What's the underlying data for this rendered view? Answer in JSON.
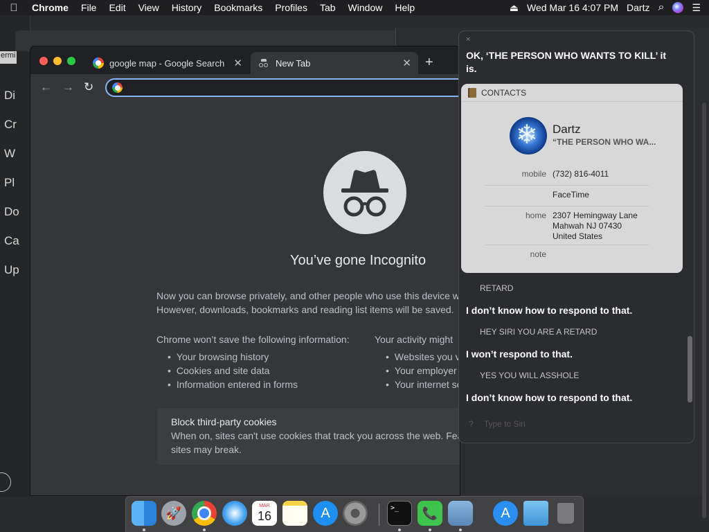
{
  "menubar": {
    "apple_icon": "apple-logo",
    "app_name": "Chrome",
    "items": [
      "File",
      "Edit",
      "View",
      "History",
      "Bookmarks",
      "Profiles",
      "Tab",
      "Window",
      "Help"
    ],
    "datetime": "Wed Mar 16  4:07 PM",
    "user": "Dartz",
    "eject_glyph": "⏏",
    "search_glyph": "⌕",
    "list_glyph": "☰"
  },
  "background_windows": {
    "terminal_tab_fragment": "ermi",
    "sidebar_letters": [
      "Di",
      "Cr",
      "W",
      "Pl",
      "Do",
      "Ca",
      "Up"
    ]
  },
  "chrome": {
    "tabs": [
      {
        "title": "google map - Google Search",
        "close": "✕"
      },
      {
        "title": "New Tab",
        "close": "✕"
      }
    ],
    "new_tab_glyph": "+",
    "back_glyph": "←",
    "forward_glyph": "→",
    "reload_glyph": "↻",
    "omnibox_value": "",
    "ntp": {
      "title": "You’ve gone Incognito",
      "para_line1": "Now you can browse privately, and other people who use this device w",
      "para_line2": "However, downloads, bookmarks and reading list items will be saved.",
      "col1_title": "Chrome won’t save the following information:",
      "col1_items": [
        "Your browsing history",
        "Cookies and site data",
        "Information entered in forms"
      ],
      "col2_title": "Your activity might",
      "col2_items": [
        "Websites you vis",
        "Your employer or",
        "Your internet ser"
      ],
      "cookie_title": "Block third-party cookies",
      "cookie_line1": "When on, sites can't use cookies that track you across the web. Fea",
      "cookie_line2": "sites may break."
    }
  },
  "siri": {
    "close_glyph": "×",
    "heading": "OK, ‘THE PERSON WHO WANTS TO KILL’ it is.",
    "contact_card": {
      "header": "CONTACTS",
      "name": "Dartz",
      "nickname": "“THE PERSON WHO WA...",
      "mobile_label": "mobile",
      "mobile_value": "(732) 816-4011",
      "facetime_value": "FaceTime",
      "home_label": "home",
      "home_line1": "2307 Hemingway Lane",
      "home_line2": "Mahwah NJ 07430",
      "home_line3": "United States",
      "note_label": "note"
    },
    "conversation": [
      {
        "user": "RETARD",
        "reply": "I don’t know how to respond to that."
      },
      {
        "user": "HEY SIRI YOU ARE A RETARD",
        "reply": "I won’t respond to that."
      },
      {
        "user": "YES YOU WILL ASSHOLE",
        "reply": "I don’t know how to respond to that."
      }
    ],
    "input_glyph": "?",
    "input_placeholder": "Type to Siri"
  },
  "dock": {
    "calendar_month": "MAR",
    "calendar_day": "16",
    "terminal_prompt": ">_",
    "appstore_glyph": "A"
  }
}
